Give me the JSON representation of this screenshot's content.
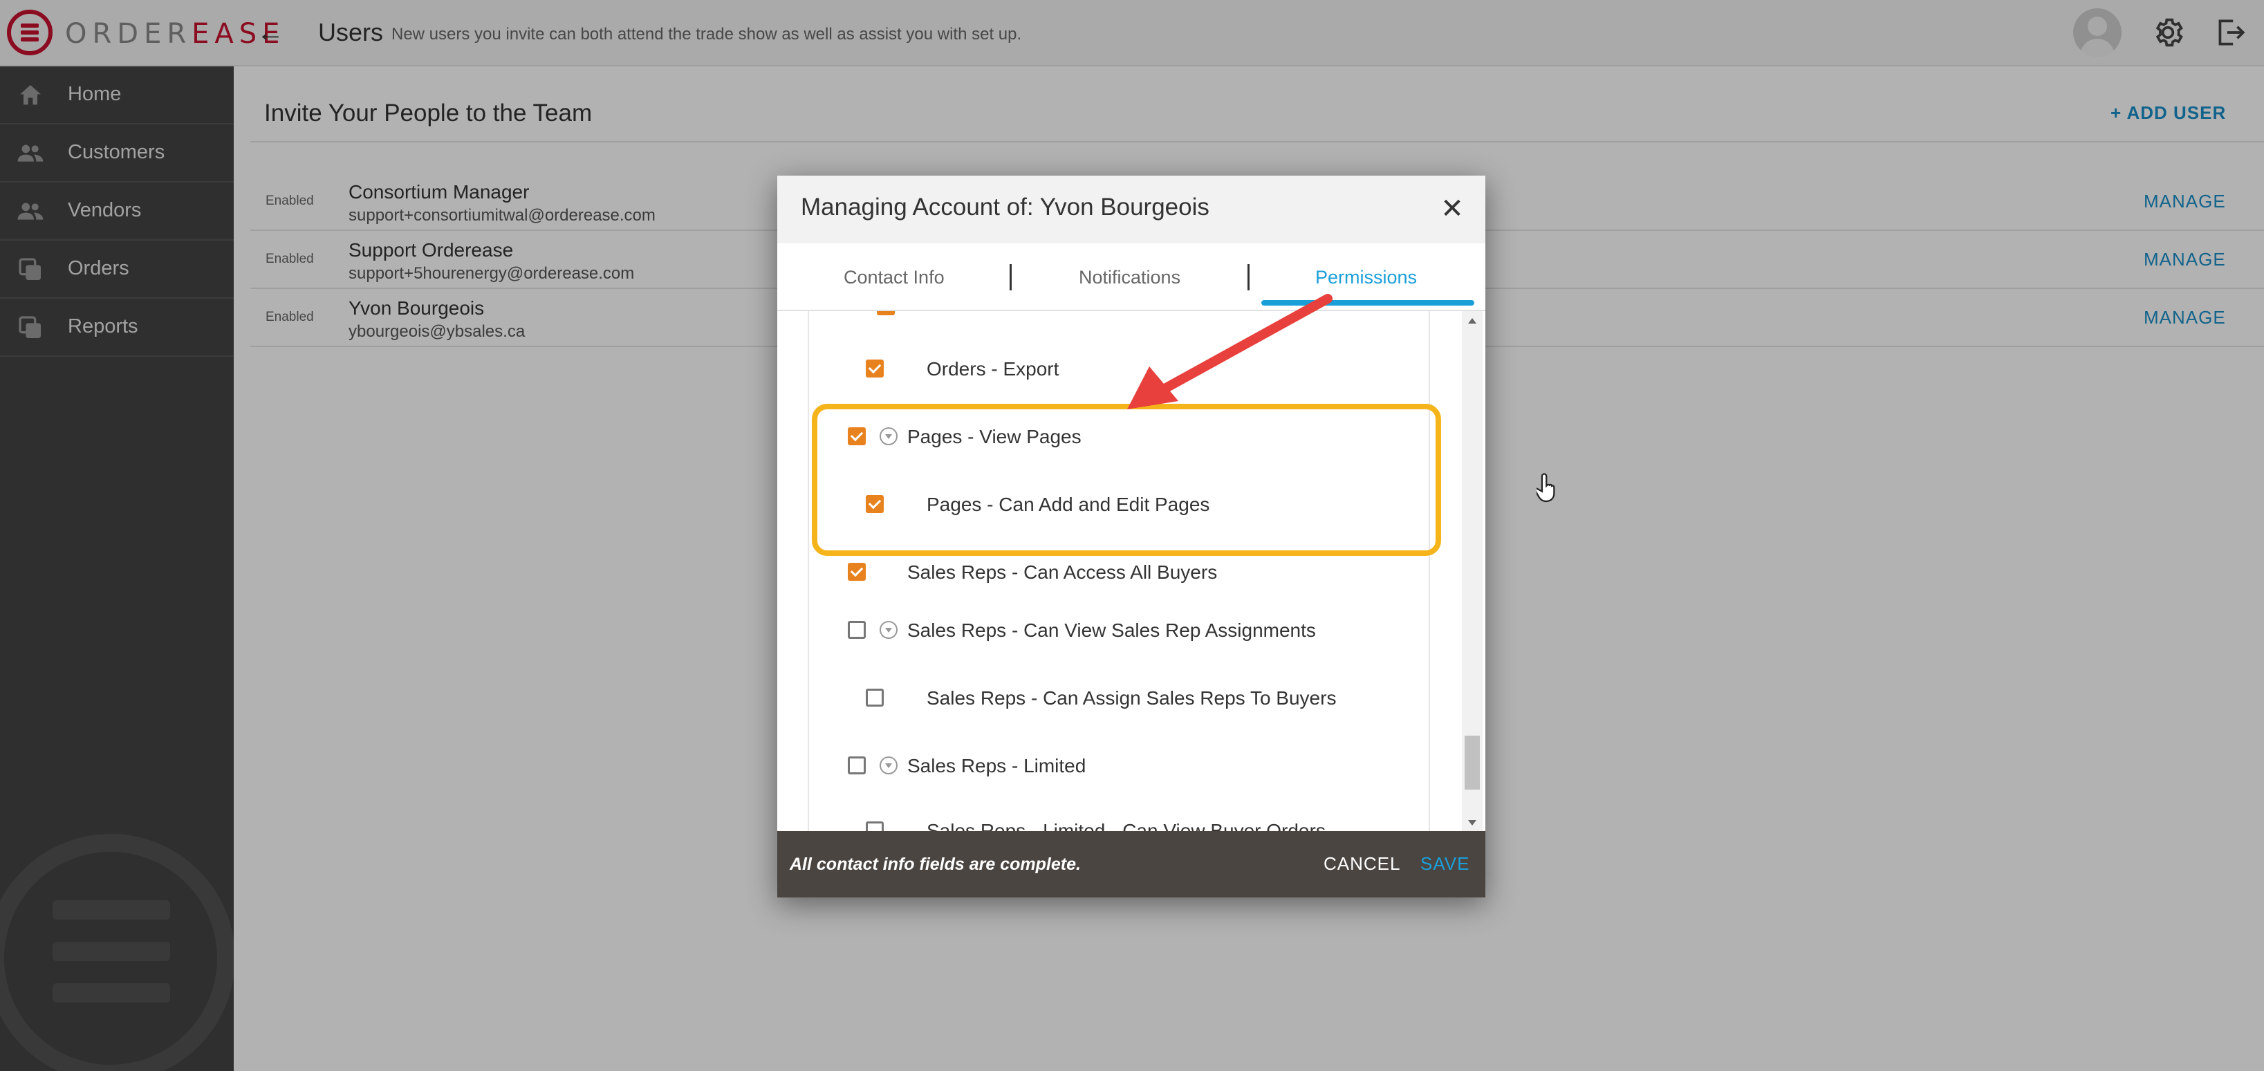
{
  "app": {
    "logo_text_a": "ORDER",
    "logo_text_b": "EASE",
    "page_title": "Users",
    "page_subtitle": "New users you invite can both attend the trade show as well as assist you with set up."
  },
  "sidebar": {
    "items": [
      {
        "label": "Home",
        "icon": "home-icon"
      },
      {
        "label": "Customers",
        "icon": "people-icon"
      },
      {
        "label": "Vendors",
        "icon": "people-icon"
      },
      {
        "label": "Orders",
        "icon": "copy-icon"
      },
      {
        "label": "Reports",
        "icon": "copy-icon"
      }
    ]
  },
  "main": {
    "section_title": "Invite Your People to the Team",
    "add_user_label": "ADD USER",
    "users": [
      {
        "status": "Enabled",
        "name": "Consortium Manager",
        "email": "support+consortiumitwal@orderease.com",
        "action": "MANAGE"
      },
      {
        "status": "Enabled",
        "name": "Support Orderease",
        "email": "support+5hourenergy@orderease.com",
        "action": "MANAGE"
      },
      {
        "status": "Enabled",
        "name": "Yvon Bourgeois",
        "email": "ybourgeois@ybsales.ca",
        "action": "MANAGE"
      }
    ]
  },
  "modal": {
    "title": "Managing Account of: Yvon Bourgeois",
    "tabs": [
      {
        "label": "Contact Info",
        "active": false
      },
      {
        "label": "Notifications",
        "active": false
      },
      {
        "label": "Permissions",
        "active": true
      }
    ],
    "permissions": [
      {
        "label": "Orders - Export",
        "checked": true,
        "indent": 1,
        "expander": false
      },
      {
        "label": "Pages - View Pages",
        "checked": true,
        "indent": 0,
        "expander": true
      },
      {
        "label": "Pages - Can Add and Edit Pages",
        "checked": true,
        "indent": 1,
        "expander": false
      },
      {
        "label": "Sales Reps - Can Access All Buyers",
        "checked": true,
        "indent": 0,
        "expander": false
      },
      {
        "label": "Sales Reps - Can View Sales Rep Assignments",
        "checked": false,
        "indent": 0,
        "expander": true
      },
      {
        "label": "Sales Reps - Can Assign Sales Reps To Buyers",
        "checked": false,
        "indent": 1,
        "expander": false
      },
      {
        "label": "Sales Reps - Limited",
        "checked": false,
        "indent": 0,
        "expander": true
      },
      {
        "label": "Sales Reps - Limited - Can View Buyer Orders",
        "checked": false,
        "indent": 1,
        "expander": false
      }
    ],
    "footer_message": "All contact info fields are complete.",
    "cancel_label": "CANCEL",
    "save_label": "SAVE"
  },
  "colors": {
    "accent_blue": "#1a8fc9",
    "checkbox_orange": "#e8821e",
    "highlight_yellow": "#f4b41a",
    "arrow_red": "#e8403c",
    "brand_red": "#c8102e",
    "sidebar_bg": "#444444"
  }
}
